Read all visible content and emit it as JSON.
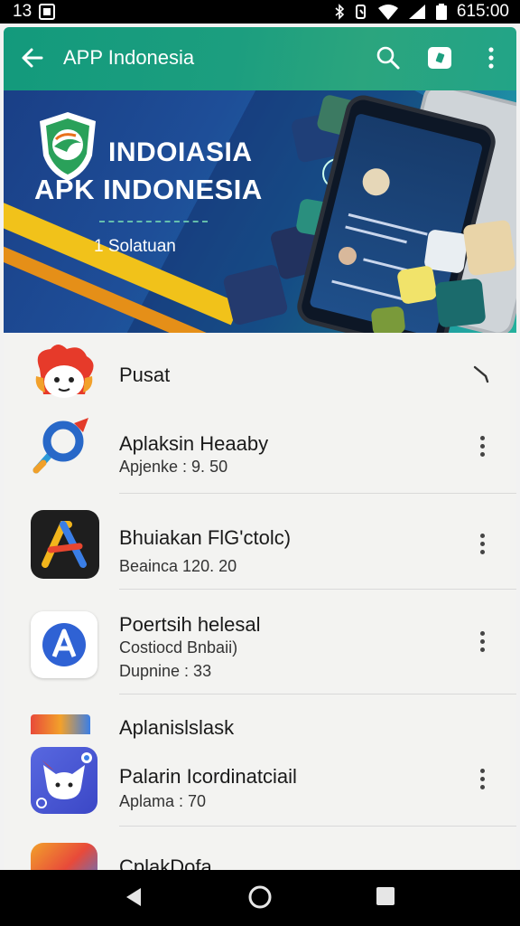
{
  "status_bar": {
    "left_text": "13",
    "time": "615:00"
  },
  "app_bar": {
    "title": "APP Indonesia"
  },
  "banner": {
    "heading_line1": "INDOIASIA",
    "heading_line2": "APK INDONESIA",
    "tagline": "1 Solatuan"
  },
  "apps": [
    {
      "name": "Pusat",
      "subtitle": "",
      "detail": "",
      "trailing": "chevron"
    },
    {
      "name": "Aplaksin Heaaby",
      "subtitle": "Apjenke  : 9. 50",
      "detail": "",
      "trailing": "menu"
    },
    {
      "name": "Bhuiakan FlG'ctolc)",
      "subtitle": "Beainca 120. 20",
      "detail": "",
      "trailing": "menu"
    },
    {
      "name": "Poertsih helesal",
      "subtitle": "Costiocd Bnbaii)",
      "detail": "Dupnine : 33",
      "trailing": "menu"
    },
    {
      "name": "Aplanislslask",
      "subtitle": "",
      "detail": "",
      "trailing": "none"
    },
    {
      "name": "Palarin Icordinatciail",
      "subtitle": "Aplama : 70",
      "detail": "",
      "trailing": "menu"
    },
    {
      "name": "CplakDofa",
      "subtitle": "",
      "detail": "",
      "trailing": "none"
    }
  ],
  "colors": {
    "app_bar": "#1c9e7f",
    "status_bar": "#000000",
    "list_bg": "#f3f3f1"
  },
  "icons": [
    "back-arrow-icon",
    "search-icon",
    "badge-icon",
    "more-vert-icon",
    "back-nav-icon",
    "home-nav-icon",
    "recents-nav-icon"
  ]
}
